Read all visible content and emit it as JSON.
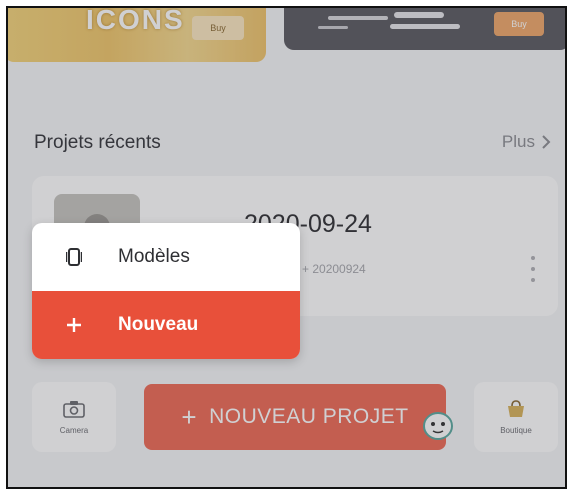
{
  "banners": {
    "left": {
      "logo_text": "ICONS",
      "button_label": "Buy"
    },
    "right": {
      "button_label": "Buy"
    }
  },
  "recent": {
    "title": "Projets récents",
    "more_label": "Plus",
    "more_icon": "chevron-right-icon"
  },
  "project": {
    "date": "2020-09-24",
    "meta": "+ 20200924"
  },
  "bottom_bar": {
    "left_label": "Camera",
    "left_icon": "camera-icon",
    "new_project_label": "NOUVEAU PROJET",
    "right_label": "Boutique",
    "right_icon": "shop-icon"
  },
  "popup": {
    "items": [
      {
        "label": "Modèles",
        "icon": "template-icon"
      },
      {
        "label": "Nouveau",
        "icon": "plus-icon"
      }
    ]
  },
  "colors": {
    "accent": "#e8503a",
    "button": "#ee6a55",
    "background": "#f5f6f7"
  }
}
